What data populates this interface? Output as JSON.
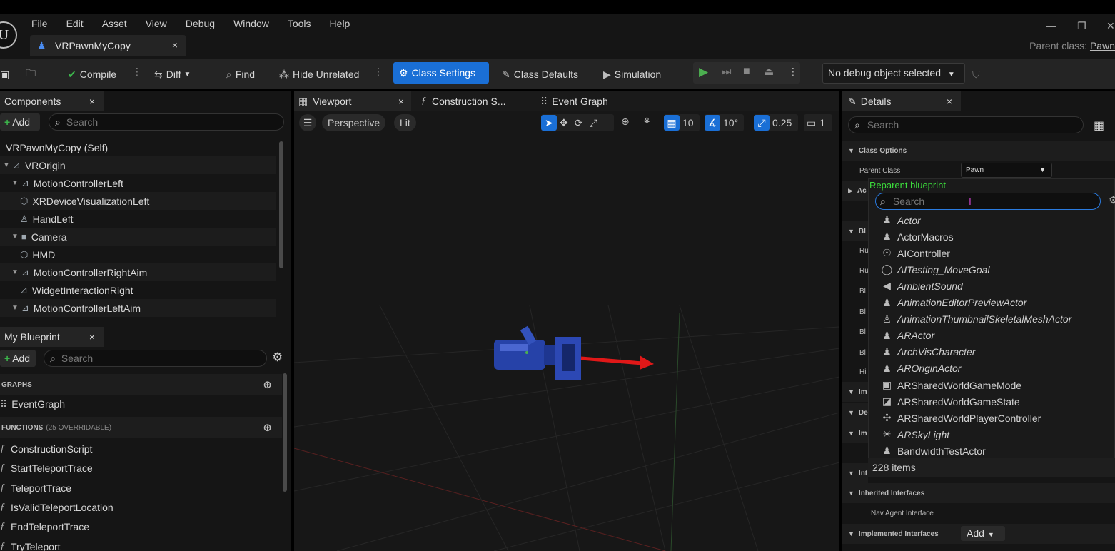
{
  "menu": [
    "File",
    "Edit",
    "Asset",
    "View",
    "Debug",
    "Window",
    "Tools",
    "Help"
  ],
  "document_tab": {
    "label": "VRPawnMyCopy",
    "close": "×"
  },
  "parent_class": {
    "label": "Parent class:",
    "value": "Pawn"
  },
  "toolbar": {
    "compile": "Compile",
    "diff": "Diff",
    "find": "Find",
    "hide_unrelated": "Hide Unrelated",
    "class_settings": "Class Settings",
    "class_defaults": "Class Defaults",
    "simulation": "Simulation",
    "debug_object": "No debug object selected"
  },
  "components": {
    "tab": "Components",
    "add": "Add",
    "search_placeholder": "Search",
    "items": [
      {
        "label": "VRPawnMyCopy (Self)",
        "indent": 0,
        "icon": "self-icon"
      },
      {
        "label": "VROrigin",
        "indent": 1,
        "icon": "scene-icon"
      },
      {
        "label": "MotionControllerLeft",
        "indent": 2,
        "icon": "motion-controller-icon"
      },
      {
        "label": "XRDeviceVisualizationLeft",
        "indent": 3,
        "icon": "mesh-icon"
      },
      {
        "label": "HandLeft",
        "indent": 3,
        "icon": "skeletal-mesh-icon"
      },
      {
        "label": "Camera",
        "indent": 2,
        "icon": "camera-icon"
      },
      {
        "label": "HMD",
        "indent": 3,
        "icon": "mesh-icon"
      },
      {
        "label": "MotionControllerRightAim",
        "indent": 2,
        "icon": "motion-controller-icon"
      },
      {
        "label": "WidgetInteractionRight",
        "indent": 3,
        "icon": "widget-interaction-icon"
      },
      {
        "label": "MotionControllerLeftAim",
        "indent": 2,
        "icon": "motion-controller-icon"
      }
    ]
  },
  "my_blueprint": {
    "tab": "My Blueprint",
    "add": "Add",
    "search_placeholder": "Search",
    "graphs_header": "GRAPHS",
    "graphs": [
      "EventGraph"
    ],
    "functions_header": "FUNCTIONS",
    "functions_note": "(25 OVERRIDABLE)",
    "functions": [
      "ConstructionScript",
      "StartTeleportTrace",
      "TeleportTrace",
      "IsValidTeleportLocation",
      "EndTeleportTrace",
      "TryTeleport"
    ]
  },
  "viewport_tabs": [
    "Viewport",
    "Construction S...",
    "Event Graph"
  ],
  "viewport": {
    "perspective": "Perspective",
    "lit": "Lit",
    "grid": "10",
    "angle": "10°",
    "scale": "0.25",
    "camera_speed": "1"
  },
  "details": {
    "tab": "Details",
    "search_placeholder": "Search",
    "class_options_header": "Class Options",
    "parent_class_label": "Parent Class",
    "parent_class_value": "Pawn",
    "rows_left": [
      "Ac",
      "Bl",
      "Ru",
      "Ru",
      "Bl",
      "Bl",
      "Bl",
      "Bl",
      "Hi",
      "Im",
      "De",
      "Im",
      "Int"
    ],
    "inherited_interfaces": "Inherited Interfaces",
    "nav_agent_interface": "Nav Agent Interface",
    "implemented_interfaces": "Implemented Interfaces",
    "add": "Add"
  },
  "reparent": {
    "title": "Reparent blueprint",
    "search_placeholder": "Search",
    "items": [
      {
        "label": "Actor",
        "italic": true,
        "icon": "actor-icon"
      },
      {
        "label": "ActorMacros",
        "italic": false,
        "icon": "actor-icon"
      },
      {
        "label": "AIController",
        "italic": false,
        "icon": "ai-controller-icon"
      },
      {
        "label": "AITesting_MoveGoal",
        "italic": true,
        "icon": "target-ring-icon"
      },
      {
        "label": "AmbientSound",
        "italic": true,
        "icon": "speaker-icon"
      },
      {
        "label": "AnimationEditorPreviewActor",
        "italic": true,
        "icon": "actor-icon"
      },
      {
        "label": "AnimationThumbnailSkeletalMeshActor",
        "italic": true,
        "icon": "skeletal-mesh-icon"
      },
      {
        "label": "ARActor",
        "italic": true,
        "icon": "actor-icon"
      },
      {
        "label": "ArchVisCharacter",
        "italic": true,
        "icon": "character-icon"
      },
      {
        "label": "AROriginActor",
        "italic": true,
        "icon": "actor-icon"
      },
      {
        "label": "ARSharedWorldGameMode",
        "italic": false,
        "icon": "game-mode-icon"
      },
      {
        "label": "ARSharedWorldGameState",
        "italic": false,
        "icon": "game-state-icon"
      },
      {
        "label": "ARSharedWorldPlayerController",
        "italic": false,
        "icon": "gamepad-icon"
      },
      {
        "label": "ARSkyLight",
        "italic": true,
        "icon": "sky-light-icon"
      },
      {
        "label": "BandwidthTestActor",
        "italic": false,
        "icon": "actor-icon"
      }
    ],
    "count": "228 items"
  },
  "colors": {
    "accent": "#1a6fd6",
    "reparent_title": "#3cdc3c",
    "play": "#4caf50"
  }
}
